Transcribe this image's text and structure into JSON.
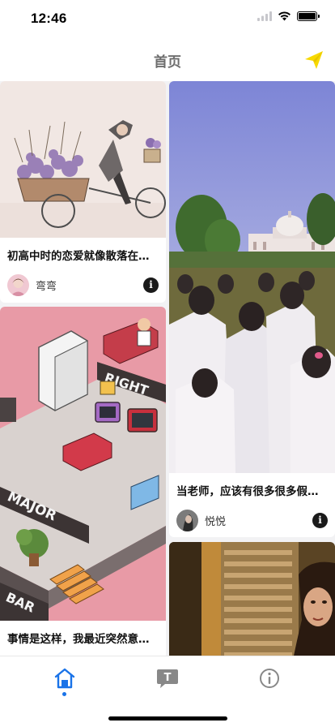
{
  "status": {
    "time": "12:46"
  },
  "nav": {
    "title": "首页"
  },
  "colors": {
    "accent": "#1a73e8",
    "send": "#f5d800",
    "tab_inactive": "#888888"
  },
  "feed": {
    "cards": [
      {
        "title": "初高中时的恋爱就像散落在…",
        "author": "弯弯",
        "image": "sketch-girl-on-tricycle-with-flowers"
      },
      {
        "title": "事情是这样，我最近突然意…",
        "author": "",
        "image": "pixel-art-isometric-room-right-major-bar"
      },
      {
        "title": "当老师，应该有很多很多假…",
        "author": "悦悦",
        "image": "students-in-white-coats-campus"
      },
      {
        "title": "",
        "author": "",
        "image": "woman-peeking-behind-shutters"
      }
    ]
  },
  "tabs": [
    {
      "name": "home",
      "icon": "home-icon",
      "active": true
    },
    {
      "name": "text",
      "icon": "text-bubble-icon",
      "active": false
    },
    {
      "name": "info",
      "icon": "info-circle-icon",
      "active": false
    }
  ]
}
